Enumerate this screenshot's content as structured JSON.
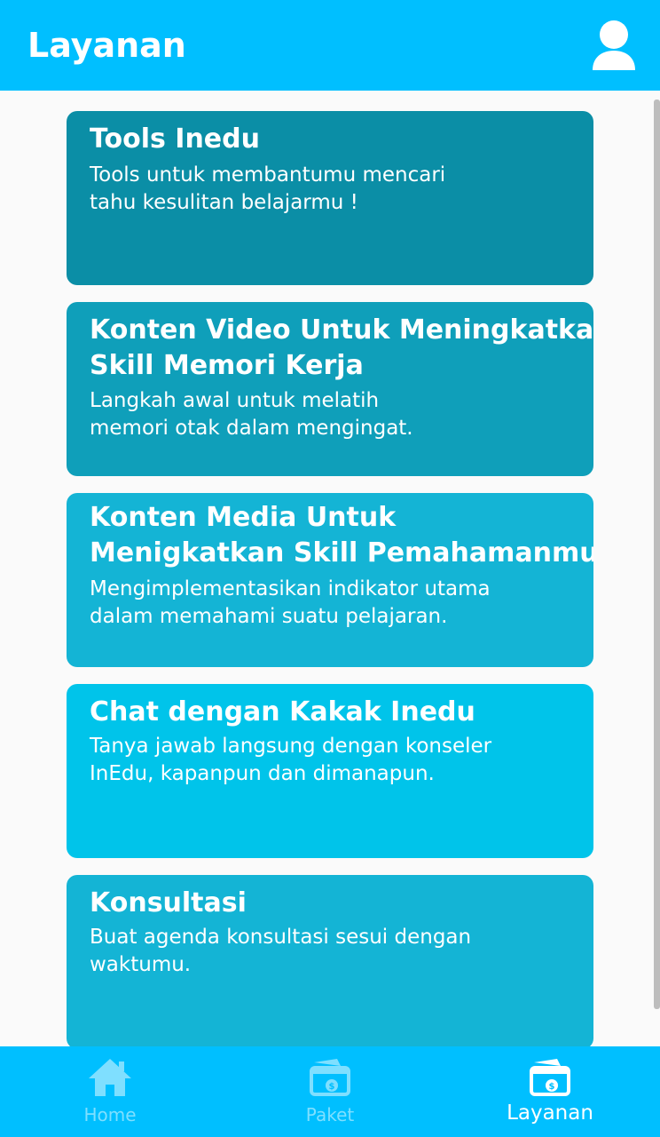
{
  "header": {
    "title": "Layanan",
    "profile_icon": "user-profile-icon"
  },
  "cards": [
    {
      "title": "Tools Inedu",
      "description": "Tools untuk membantumu mencari\ntahu kesulitan belajarmu !",
      "color": "#0b8ea6"
    },
    {
      "title": "Konten Video Untuk Meningkatkan\nSkill Memori Kerja",
      "description": "Langkah awal untuk melatih\nmemori otak dalam mengingat.",
      "color": "#0f9fba"
    },
    {
      "title": "Konten Media Untuk\nMenigkatkan Skill Pemahamanmu",
      "description": "Mengimplementasikan indikator utama\ndalam memahami suatu pelajaran.",
      "color": "#14b4d5"
    },
    {
      "title": "Chat dengan Kakak Inedu",
      "description": "Tanya jawab langsung dengan konseler\nInEdu, kapanpun dan dimanapun.",
      "color": "#00c4ea"
    },
    {
      "title": "Konsultasi",
      "description": "Buat agenda konsultasi sesui dengan\nwaktumu.",
      "color": "#14b4d5"
    }
  ],
  "bottom_nav": {
    "items": [
      {
        "label": "Home",
        "icon": "home-icon",
        "active": false
      },
      {
        "label": "Paket",
        "icon": "paket-icon",
        "active": false
      },
      {
        "label": "Layanan",
        "icon": "layanan-icon",
        "active": true
      }
    ]
  },
  "colors": {
    "primary": "#00bfff",
    "background": "#fafafa",
    "nav_inactive": "#7fdfff",
    "nav_active": "#ffffff"
  }
}
